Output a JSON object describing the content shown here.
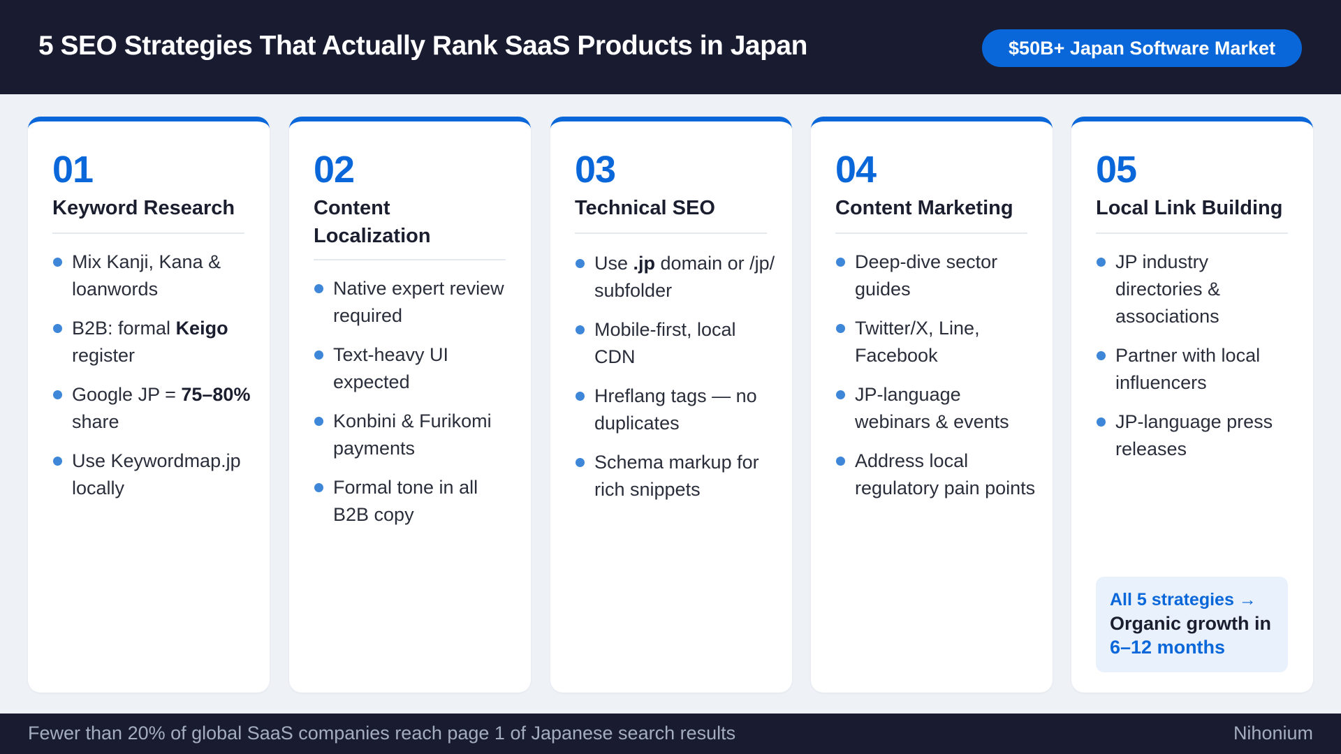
{
  "header": {
    "title": "5 SEO Strategies That Actually Rank SaaS Products in Japan",
    "badge": "$50B+ Japan Software Market"
  },
  "cards": [
    {
      "number": "01",
      "title": "Keyword Research",
      "bullets": [
        {
          "pre": "Mix Kanji, Kana & loanwords",
          "bold": "",
          "post": ""
        },
        {
          "pre": "B2B: formal ",
          "bold": "Keigo",
          "post": " register"
        },
        {
          "pre": "Google JP = ",
          "bold": "75–80%",
          "post": " share"
        },
        {
          "pre": "Use Keywordmap.jp locally",
          "bold": "",
          "post": ""
        }
      ]
    },
    {
      "number": "02",
      "title": "Content Localization",
      "bullets": [
        {
          "pre": "Native expert review required",
          "bold": "",
          "post": ""
        },
        {
          "pre": "Text-heavy UI expected",
          "bold": "",
          "post": ""
        },
        {
          "pre": "Konbini & Furikomi payments",
          "bold": "",
          "post": ""
        },
        {
          "pre": "Formal tone in all B2B copy",
          "bold": "",
          "post": ""
        }
      ]
    },
    {
      "number": "03",
      "title": "Technical SEO",
      "bullets": [
        {
          "pre": "Use ",
          "bold": ".jp",
          "post": " domain or /jp/ subfolder"
        },
        {
          "pre": "Mobile-first, local CDN",
          "bold": "",
          "post": ""
        },
        {
          "pre": "Hreflang tags — no duplicates",
          "bold": "",
          "post": ""
        },
        {
          "pre": "Schema markup for rich snippets",
          "bold": "",
          "post": ""
        }
      ]
    },
    {
      "number": "04",
      "title": "Content Marketing",
      "bullets": [
        {
          "pre": "Deep-dive sector guides",
          "bold": "",
          "post": ""
        },
        {
          "pre": "Twitter/X, Line, Facebook",
          "bold": "",
          "post": ""
        },
        {
          "pre": "JP-language webinars & events",
          "bold": "",
          "post": ""
        },
        {
          "pre": "Address local regulatory pain points",
          "bold": "",
          "post": ""
        }
      ]
    },
    {
      "number": "05",
      "title": "Local Link Building",
      "bullets": [
        {
          "pre": "JP industry directories & associations",
          "bold": "",
          "post": ""
        },
        {
          "pre": "Partner with local influencers",
          "bold": "",
          "post": ""
        },
        {
          "pre": "JP-language press releases",
          "bold": "",
          "post": ""
        }
      ]
    }
  ],
  "summary": {
    "line1": "All 5 strategies →",
    "line2": "Organic growth in ",
    "highlight": "6–12 months"
  },
  "footer": {
    "stat": "Fewer than 20% of global SaaS companies reach page 1 of Japanese search results",
    "brand": "Nihonium"
  }
}
